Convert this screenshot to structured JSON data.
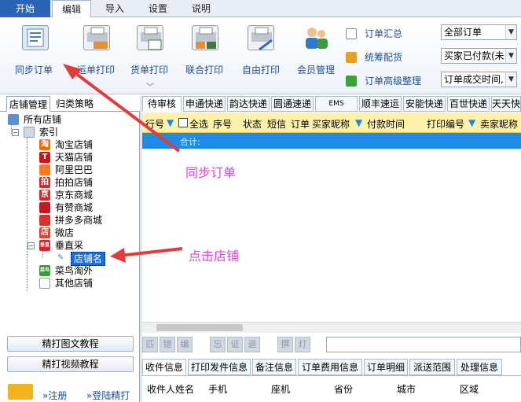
{
  "menu": {
    "tabs": [
      "开始",
      "编辑",
      "导入",
      "设置",
      "说明"
    ]
  },
  "ribbon": {
    "sync_order": "同步订单",
    "waybill_print": "运单打印",
    "goods_print": "货单打印",
    "combined_print": "联合打印",
    "free_print": "自由打印",
    "member_mgmt": "会员管理",
    "order_summary": "订单汇总",
    "coordinated_dist": "统筹配货",
    "order_advanced": "订单高级整理",
    "combo_all_orders": "全部订单",
    "combo_paid": "买家已付款(未",
    "combo_time": "订单成交时间,"
  },
  "left_panel": {
    "tabs": [
      "店铺管理",
      "归类策略"
    ],
    "tree": {
      "root": "所有店铺",
      "index": "索引",
      "shops": [
        "淘宝店铺",
        "天猫店铺",
        "阿里巴巴",
        "拍拍店铺",
        "京东商城",
        "有赞商城",
        "拼多多商城",
        "微店",
        "垂直采"
      ],
      "shop_icons": [
        "淘",
        "T",
        "",
        "拍",
        "京",
        "",
        "",
        "店",
        "垂直"
      ],
      "child_shop": "店铺名",
      "more": [
        "菜鸟淘外",
        "其他店铺"
      ],
      "more_icons": [
        "菜鸟",
        ""
      ]
    },
    "btn_tutorial_img": "精打图文教程",
    "btn_tutorial_video": "精打视频教程",
    "register": "»注册",
    "login": "»登陆精打"
  },
  "right_panel": {
    "carrier_tabs": [
      "待审核",
      "申通快递",
      "韵达快递",
      "圆通速递",
      "EMS",
      "顺丰速运",
      "安能快递",
      "百世快递",
      "天天快"
    ],
    "grid_headers": [
      "行号",
      "全选",
      "序号",
      "状态",
      "短信",
      "订单",
      "买家昵称",
      "付款时间",
      "打印编号",
      "卖家昵称"
    ],
    "sum_label": "合计:",
    "toolbar_buttons": [
      "匹",
      "错",
      "编",
      "忘",
      "证",
      "退",
      "撰",
      "灯"
    ],
    "bottom_tabs": [
      "收件信息",
      "打印发件信息",
      "备注信息",
      "订单费用信息",
      "订单明细",
      "派送范围",
      "处理信息"
    ],
    "bottom_headers": [
      "收件人姓名",
      "手机",
      "座机",
      "省份",
      "城市",
      "区域"
    ]
  },
  "annotations": {
    "sync_order": "同步订单",
    "click_shop": "点击店铺"
  },
  "colors": {
    "accent": "#2b63b6",
    "header_yellow": "#fff1a8",
    "sum_blue": "#1d8be8",
    "annotation_red": "#e23b3b",
    "annotation_text": "#e040e0"
  }
}
